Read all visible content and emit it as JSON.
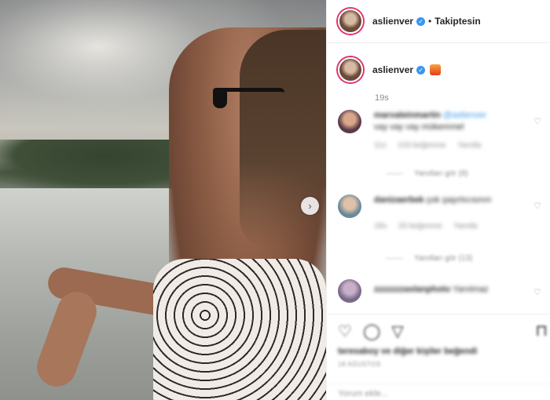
{
  "post": {
    "author": "aslienver",
    "follow_label": "Takiptesin",
    "separator": "•",
    "next_icon": "›",
    "caption_time": "19s"
  },
  "comments": [
    {
      "user": "marvaleinmartin",
      "mention": "@aslienver",
      "text": "vay vay vay mükemmel",
      "time": "11s",
      "likes": "103 beğenme",
      "reply": "Yanıtla",
      "view_replies": "Yanıtları gör (8)",
      "avatar_color": "#5a3a4a"
    },
    {
      "user": "danizaerbek",
      "mention": "",
      "text": "çok şaşırtıcısının",
      "time": "18s",
      "likes": "33 beğenme",
      "reply": "Yanıtla",
      "view_replies": "Yanıtları gör (13)",
      "avatar_color": "#6a8a9a"
    },
    {
      "user": "zzzzzzzaslanphoto",
      "mention": "",
      "text": "Yanıtmaz",
      "avatar_color": "#7a6a8a"
    }
  ],
  "actions": {
    "like_icon": "♡",
    "comment_icon": "◯",
    "share_icon": "▽",
    "save_icon": "⊓",
    "likes_text": "teresaboy ve diğer kişiler beğendi",
    "date_text": "18 AĞUSTOS",
    "add_comment_placeholder": "Yorum ekle..."
  },
  "colors": {
    "verified": "#3897f0",
    "story_ring": "#e1306c"
  }
}
